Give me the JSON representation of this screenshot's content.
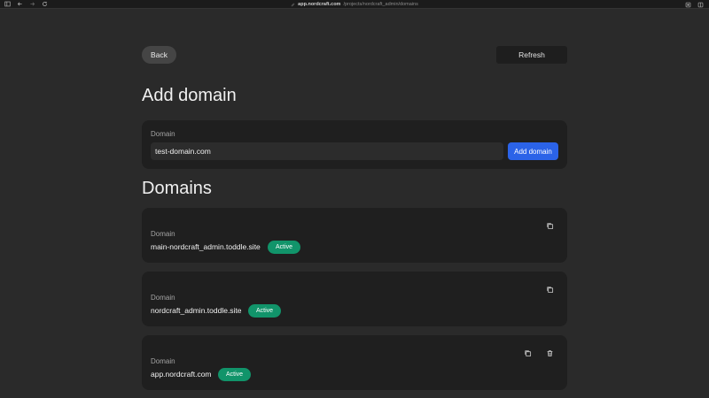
{
  "browser": {
    "url_host": "app.nordcraft.com",
    "url_path": "/projects/nordcraft_admin/domains"
  },
  "toolbar": {
    "back_label": "Back",
    "refresh_label": "Refresh"
  },
  "add_section": {
    "title": "Add domain",
    "field_label": "Domain",
    "input_value": "test-domain.com",
    "add_button_label": "Add domain"
  },
  "domains_section": {
    "title": "Domains",
    "items": [
      {
        "label": "Domain",
        "value": "main-nordcraft_admin.toddle.site",
        "status": "Active"
      },
      {
        "label": "Domain",
        "value": "nordcraft_admin.toddle.site",
        "status": "Active"
      },
      {
        "label": "Domain",
        "value": "app.nordcraft.com",
        "status": "Active"
      }
    ]
  },
  "colors": {
    "background": "#2a2a2a",
    "card": "#1f1f1f",
    "accent_blue": "#2b63e8",
    "status_green": "#11946a"
  }
}
